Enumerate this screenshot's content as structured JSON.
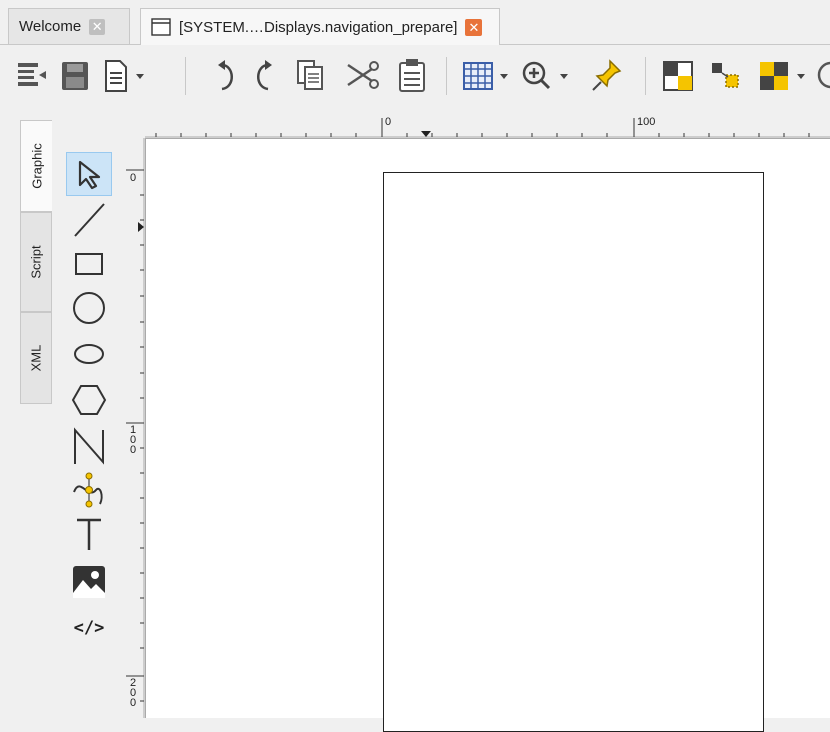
{
  "tabs": [
    {
      "label": "Welcome",
      "close_icon": "close-icon",
      "active": false
    },
    {
      "label": "[SYSTEM.…Displays.navigation_prepare]",
      "close_icon": "close-icon",
      "active": true
    }
  ],
  "toolbar": {
    "icons": [
      "outline-icon",
      "save-icon",
      "page-icon",
      "dropdown-arrow-icon",
      "undo-icon",
      "redo-icon",
      "copy-icon",
      "cut-icon",
      "paste-icon",
      "grid-icon",
      "zoom-in-icon",
      "pin-icon",
      "fill-color-icon",
      "snap-icon",
      "pattern-icon"
    ]
  },
  "side_tabs": [
    "Graphic",
    "Script",
    "XML"
  ],
  "tools": [
    "select-tool",
    "line-tool",
    "rectangle-tool",
    "circle-tool",
    "ellipse-tool",
    "polygon-tool",
    "polyline-tool",
    "curve-tool",
    "text-tool",
    "image-tool",
    "html-tool"
  ],
  "tool_labels": {
    "text": "T",
    "html": "</>"
  },
  "ruler": {
    "h_labels": [
      "0",
      "100"
    ],
    "v_labels": [
      "0",
      "100",
      "200"
    ]
  },
  "colors": {
    "accent_yellow": "#f5c400",
    "close_red": "#e8733a",
    "grid_blue": "#3a5ea8"
  }
}
